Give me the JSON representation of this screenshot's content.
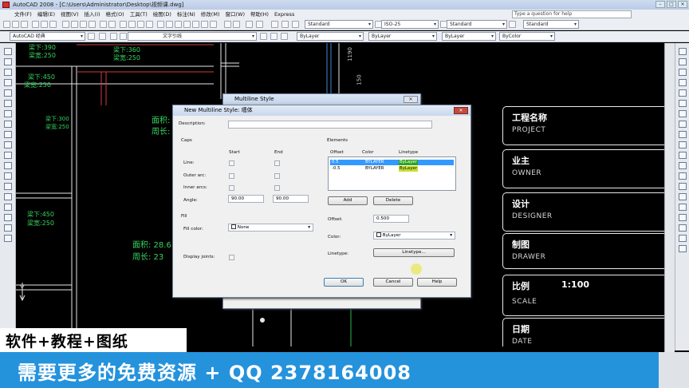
{
  "titlebar": {
    "title": "AutoCAD 2008 - [C:\\Users\\Administrator\\Desktop\\视频课.dwg]"
  },
  "menubar": {
    "items": [
      "文件(F)",
      "编辑(E)",
      "视图(V)",
      "插入(I)",
      "格式(O)",
      "工具(T)",
      "绘图(D)",
      "标注(N)",
      "修改(M)",
      "窗口(W)",
      "帮助(H)",
      "Express"
    ],
    "help_placeholder": "Type a question for help"
  },
  "toolbar": {
    "text_style": "Standard",
    "dim_style": "ISO-25",
    "table_style": "Standard",
    "mleader_style": "Standard",
    "workspace": "AutoCAD 经典",
    "layer_text": "文字引线",
    "color": "ByLayer",
    "linetype": "ByLayer",
    "lineweight": "ByLayer",
    "plotstyle": "ByColor"
  },
  "drawing": {
    "beam1_a": "梁下:390",
    "beam1_b": "梁宽:250",
    "beam2_a": "梁下:360",
    "beam2_b": "梁宽:250",
    "beam3_a": "梁下:450",
    "beam3_b": "梁宽:250",
    "beam4_a": "梁下:300",
    "beam4_b": "梁宽:250",
    "beam5_a": "梁下:450",
    "beam5_b": "梁宽:250",
    "area1": "面积:",
    "perim1": "周长:",
    "area2": "面积: 28.6",
    "perim2": "周长: 23",
    "dim1": "1190",
    "dim2": "150",
    "axis_y": "Y"
  },
  "title_block": [
    {
      "title": "工程名称",
      "sub": "PROJECT",
      "value": ""
    },
    {
      "title": "业主",
      "sub": "OWNER",
      "value": ""
    },
    {
      "title": "设计",
      "sub": "DESIGNER",
      "value": ""
    },
    {
      "title": "制图",
      "sub": "DRAWER",
      "value": ""
    },
    {
      "title": "比例",
      "sub": "SCALE",
      "value": "1:100"
    },
    {
      "title": "日期",
      "sub": "DATE",
      "value": ""
    }
  ],
  "back_dialog": {
    "title": "Multiline Style"
  },
  "dialog": {
    "title": "New Multiline Style: 墙体",
    "description_label": "Description:",
    "description_value": "",
    "caps_label": "Caps",
    "start_label": "Start",
    "end_label": "End",
    "line_label": "Line:",
    "outer_label": "Outer arc:",
    "inner_label": "Inner arcs:",
    "angle_label": "Angle:",
    "angle_start": "90.00",
    "angle_end": "90.00",
    "fill_label": "Fill",
    "fill_color_label": "Fill color:",
    "fill_color_value": "None",
    "joints_label": "Display joints:",
    "elements_label": "Elements",
    "col_offset": "Offset",
    "col_color": "Color",
    "col_linetype": "Linetype",
    "rows": [
      {
        "offset": "0.5",
        "color": "BYLAYER",
        "linetype": "ByLayer"
      },
      {
        "offset": "-0.5",
        "color": "BYLAYER",
        "linetype": "ByLayer"
      }
    ],
    "add_label": "Add",
    "delete_label": "Delete",
    "offset_label": "Offset:",
    "offset_value": "0.500",
    "color_label": "Color:",
    "color_value": "ByLayer",
    "linetype_label": "Linetype:",
    "linetype_button": "Linetype...",
    "ok_label": "OK",
    "cancel_label": "Cancel",
    "help_label": "Help"
  },
  "banner": {
    "top": "软件+教程+图纸",
    "bottom": "需要更多的免费资源 + QQ 2378164008"
  },
  "colors": {
    "banner_blue": "#2592dc",
    "cad_green": "#36d35f",
    "selection": "#3399ff"
  }
}
